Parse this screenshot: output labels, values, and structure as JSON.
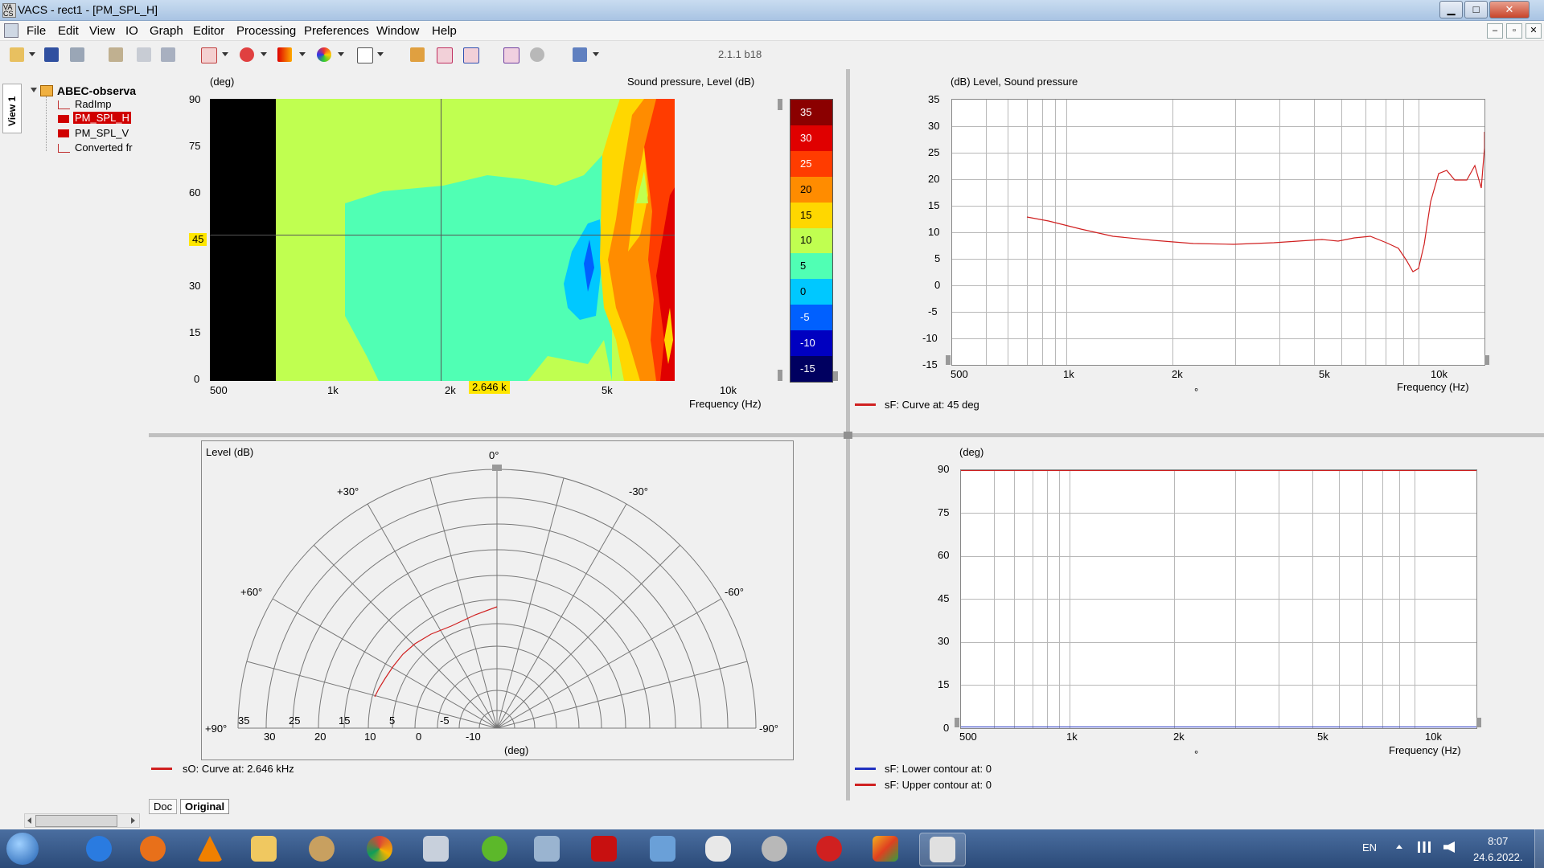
{
  "window": {
    "title": "VACS - rect1 - [PM_SPL_H]",
    "min": "▁",
    "max": "□",
    "close": "✕"
  },
  "menu": [
    "File",
    "Edit",
    "View",
    "IO",
    "Graph",
    "Editor",
    "Processing",
    "Preferences",
    "Window",
    "Help"
  ],
  "mdi_buttons": [
    "–",
    "▫",
    "✕"
  ],
  "toolbar": {
    "version": "2.1.1 b18"
  },
  "sidebar": {
    "tab": "View 1",
    "root": "ABEC-observa",
    "items": [
      {
        "label": "RadImp",
        "icon": "line-icon"
      },
      {
        "label": "PM_SPL_H",
        "icon": "map-icon",
        "selected": true
      },
      {
        "label": "PM_SPL_V",
        "icon": "map-icon"
      },
      {
        "label": "Converted fr",
        "icon": "line-icon"
      }
    ]
  },
  "contour": {
    "ylabel": "(deg)",
    "title": "Sound pressure, Level  (dB)",
    "yticks": [
      "90",
      "75",
      "60",
      "45",
      "30",
      "15",
      "0"
    ],
    "xticks": [
      "500",
      "1k",
      "2k",
      "5k",
      "10k"
    ],
    "xlabel": "Frequency  (Hz)",
    "cursor_x": "2.646 k",
    "cursor_y": "45",
    "colorbar": [
      "35",
      "30",
      "25",
      "20",
      "15",
      "10",
      "5",
      "0",
      "-5",
      "-10",
      "-15"
    ],
    "colorbar_colors": [
      "#8b0000",
      "#e00000",
      "#ff3c00",
      "#ff8c00",
      "#ffd700",
      "#c0ff50",
      "#50ffb4",
      "#00c8ff",
      "#0060ff",
      "#0000c0",
      "#000060"
    ]
  },
  "freq_plot": {
    "ylabel": "(dB)  Level, Sound pressure",
    "yticks": [
      "35",
      "30",
      "25",
      "20",
      "15",
      "10",
      "5",
      "0",
      "-5",
      "-10",
      "-15"
    ],
    "xticks": [
      "500",
      "1k",
      "2k",
      "5k",
      "10k"
    ],
    "xlabel": "Frequency  (Hz)",
    "legend": "sF: Curve at: 45 deg",
    "legend_color": "#d02020",
    "degree": "°"
  },
  "polar": {
    "ylabel": "Level  (dB)",
    "angles": [
      "0°",
      "+30°",
      "-30°",
      "+60°",
      "-60°",
      "+90°",
      "-90°"
    ],
    "scale": [
      "35",
      "25",
      "15",
      "5",
      "-5"
    ],
    "bottom_ticks": [
      "30",
      "20",
      "10",
      "0",
      "-10"
    ],
    "xlabel": "(deg)",
    "legend": "sO: Curve at: 2.646 kHz",
    "legend_color": "#d02020"
  },
  "contour_limits": {
    "ylabel": "(deg)",
    "yticks": [
      "90",
      "75",
      "60",
      "45",
      "30",
      "15",
      "0"
    ],
    "xticks": [
      "500",
      "1k",
      "2k",
      "5k",
      "10k"
    ],
    "xlabel": "Frequency  (Hz)",
    "legend": [
      {
        "label": "sF: Lower contour at: 0",
        "color": "#2030c0"
      },
      {
        "label": "sF: Upper contour at: 0",
        "color": "#d02020"
      }
    ]
  },
  "tabs": [
    "Doc",
    "Original"
  ],
  "tray": {
    "lang": "EN",
    "time": "8:07",
    "date": "24.6.2022."
  }
}
